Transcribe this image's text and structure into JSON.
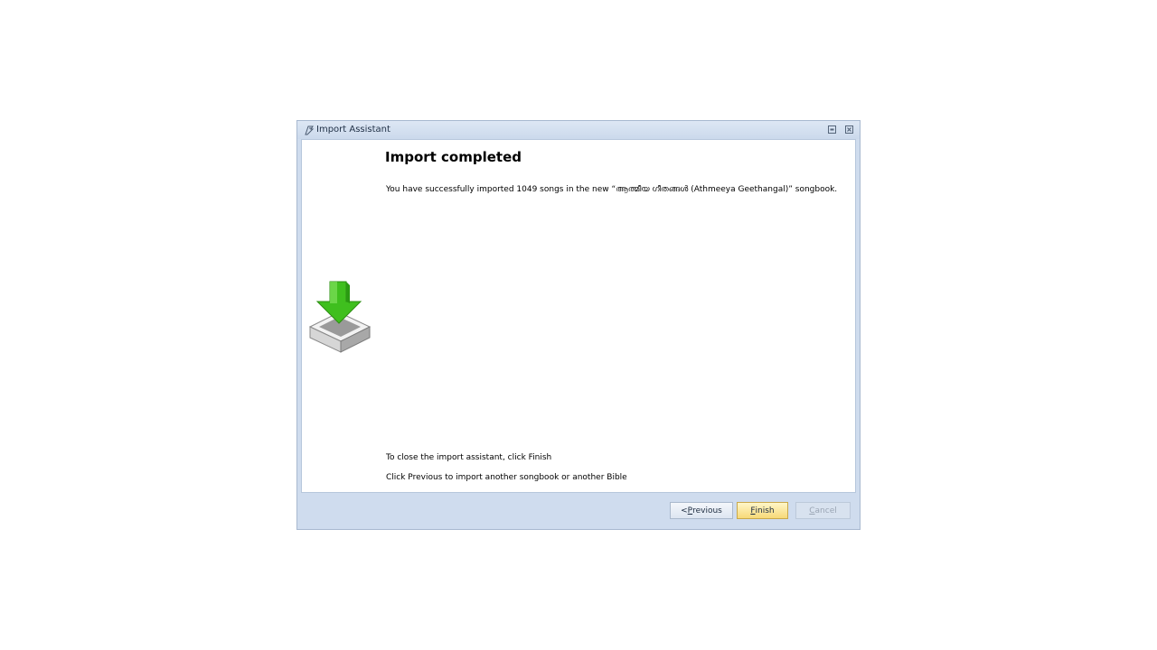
{
  "window": {
    "title": "Import Assistant",
    "icon": "song-import-icon"
  },
  "page": {
    "heading": "Import completed",
    "message": "You have successfully imported 1049 songs in the new “ആത്മീയ ഗീതങ്ങൾ (Athmeeya Geethangal)” songbook.",
    "hint_finish": "To close the import assistant, click Finish",
    "hint_previous": "Click Previous to import another songbook or another Bible"
  },
  "buttons": {
    "previous": {
      "prefix": "< ",
      "mnemonic": "P",
      "rest": "revious",
      "enabled": true
    },
    "finish": {
      "prefix": "",
      "mnemonic": "F",
      "rest": "inish",
      "enabled": true,
      "default": true
    },
    "cancel": {
      "prefix": "",
      "mnemonic": "C",
      "rest": "ancel",
      "enabled": false
    }
  },
  "colors": {
    "frame": "#cfdcee",
    "finish_highlight": "#f7d978",
    "arrow_green": "#3fbf1e"
  }
}
